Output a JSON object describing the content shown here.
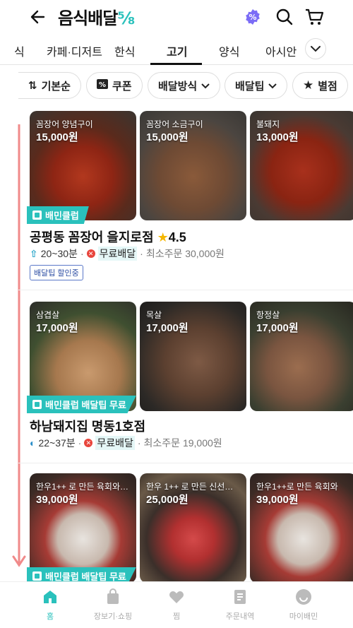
{
  "header": {
    "title_main": "음식배달",
    "title_accent": "⅝"
  },
  "categories": [
    "식",
    "카페·디저트",
    "한식",
    "고기",
    "양식",
    "아시안"
  ],
  "active_category": "고기",
  "filters": {
    "sort": "기본순",
    "coupon": "쿠폰",
    "delivery_method": "배달방식",
    "delivery_tip": "배달팁",
    "rating": "별점"
  },
  "stores": [
    {
      "name": "공평동 꼼장어 을지로점",
      "rating": "4.5",
      "badge": "배민클럽",
      "eta": "20~30분",
      "free_delivery": "무료배달",
      "min_order": "최소주문 30,000원",
      "tag": "배달팁 할인중",
      "menu": [
        {
          "label": "꼼장어 양념구이",
          "price": "15,000원"
        },
        {
          "label": "꼼장어 소금구이",
          "price": "15,000원"
        },
        {
          "label": "불돼지",
          "price": "13,000원"
        }
      ]
    },
    {
      "name": "하남돼지집 명동1호점",
      "badge": "배민클럽 배달팁 무료",
      "eta": "22~37분",
      "free_delivery": "무료배달",
      "min_order": "최소주문 19,000원",
      "menu": [
        {
          "label": "삼겹살",
          "price": "17,000원"
        },
        {
          "label": "목살",
          "price": "17,000원"
        },
        {
          "label": "항정살",
          "price": "17,000원"
        }
      ]
    },
    {
      "badge": "배민클럽 배달팁 무료",
      "menu": [
        {
          "label": "한우1++ 로 만든 육회와…",
          "price": "39,000원"
        },
        {
          "label": "한우 1++ 로 만든  신선…",
          "price": "25,000원"
        },
        {
          "label": "한우1++로 만든 육회와",
          "price": "39,000원"
        }
      ]
    }
  ],
  "bottom_nav": [
    "홈",
    "장보기·쇼핑",
    "찜",
    "주문내역",
    "마이배민"
  ],
  "colors": {
    "accent": "#2ac1bc",
    "scroll_arrow": "#f08a8a"
  }
}
